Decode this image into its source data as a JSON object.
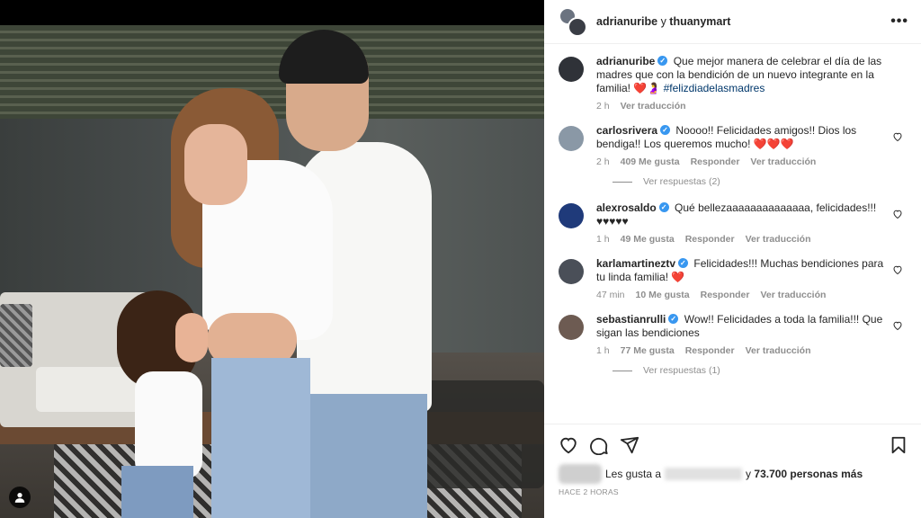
{
  "header": {
    "user1": "adrianuribe",
    "connector": "y",
    "user2": "thuanymart"
  },
  "caption": {
    "username": "adrianuribe",
    "text": "Que mejor manera de celebrar el día de las madres que con la bendición de un nuevo integrante en la familia!",
    "emoji": "❤️🤰",
    "hashtag": "#felizdiadelasmadres",
    "time": "2 h",
    "translate": "Ver traducción"
  },
  "comments": [
    {
      "username": "carlosrivera",
      "text": "Noooo!! Felicidades amigos!! Dios los bendiga!! Los queremos mucho!",
      "emoji": "❤️❤️❤️",
      "time": "2 h",
      "likes": "409 Me gusta",
      "reply": "Responder",
      "translate": "Ver traducción",
      "replies": "Ver respuestas (2)"
    },
    {
      "username": "alexrosaldo",
      "text": "Qué bellezaaaaaaaaaaaaaa, felicidades!!!",
      "emoji": "♥♥♥♥♥",
      "time": "1 h",
      "likes": "49 Me gusta",
      "reply": "Responder",
      "translate": "Ver traducción"
    },
    {
      "username": "karlamartineztv",
      "text": "Felicidades!!! Muchas bendiciones para tu linda familia!",
      "emoji": "❤️",
      "time": "47 min",
      "likes": "10 Me gusta",
      "reply": "Responder",
      "translate": "Ver traducción"
    },
    {
      "username": "sebastianrulli",
      "text": "Wow!! Felicidades a toda la familia!!! Que sigan las bendiciones",
      "emoji": "",
      "time": "1 h",
      "likes": "77 Me gusta",
      "reply": "Responder",
      "translate": "Ver traducción",
      "replies": "Ver respuestas (1)"
    }
  ],
  "likes_line": {
    "prefix": "Les gusta a",
    "connector": "y",
    "count": "73.700 personas más"
  },
  "posted_ago": "HACE 2 HORAS",
  "colors": {
    "verified": "#3897f0",
    "heart": "#ed1c39",
    "muted": "#8e8e8e",
    "hashtag": "#00376b"
  }
}
